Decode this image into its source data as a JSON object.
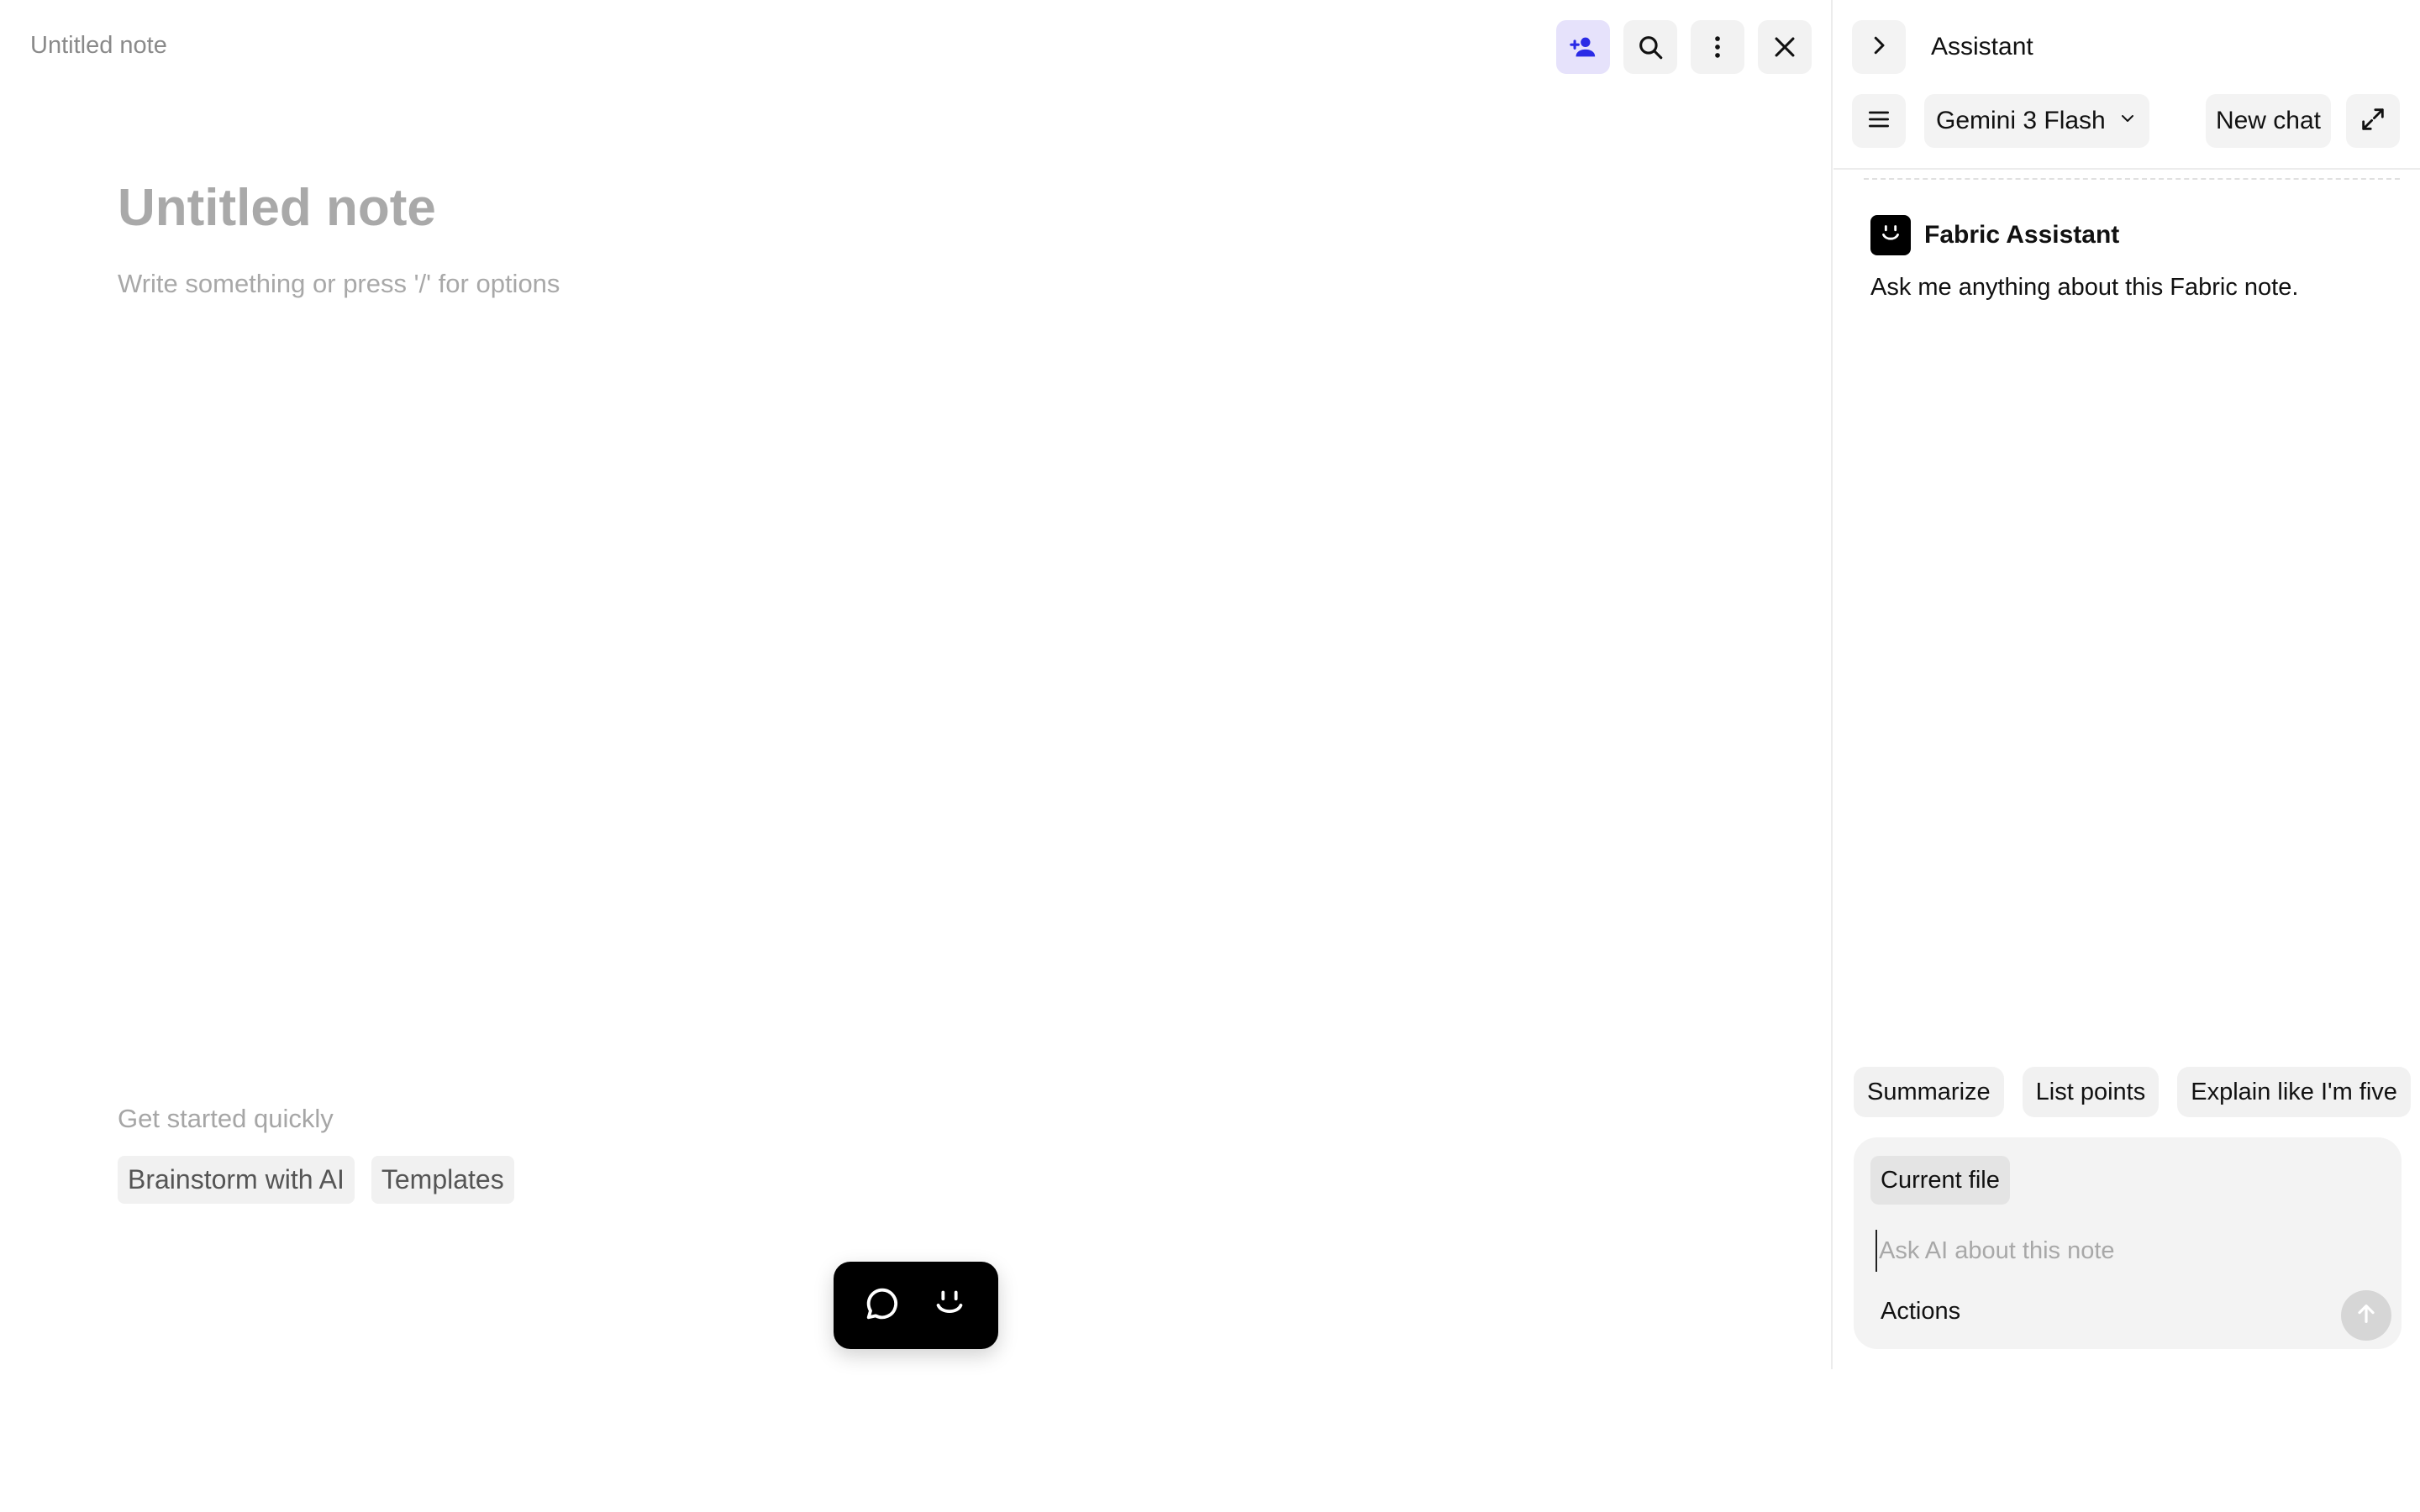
{
  "editor": {
    "breadcrumb_title": "Untitled note",
    "title_placeholder": "Untitled note",
    "body_placeholder": "Write something or press '/' for options",
    "quick_start": {
      "heading": "Get started quickly",
      "chips": [
        "Brainstorm with AI",
        "Templates"
      ]
    },
    "toolbar": {
      "icons": [
        "add-person-icon",
        "search-icon",
        "more-vertical-icon",
        "close-icon"
      ]
    },
    "floating_bar": {
      "icons": [
        "chat-bubble-icon",
        "assistant-face-icon"
      ]
    }
  },
  "assistant": {
    "title": "Assistant",
    "model": "Gemini 3 Flash",
    "new_chat_label": "New chat",
    "message": {
      "sender": "Fabric Assistant",
      "text": "Ask me anything about this Fabric note."
    },
    "suggestions": [
      "Summarize",
      "List points",
      "Explain like I'm five"
    ],
    "composer": {
      "context_chip": "Current file",
      "placeholder": "Ask AI about this note",
      "actions_label": "Actions"
    }
  },
  "colors": {
    "accent": "#2a2ae6",
    "accent_bg": "#e6e2fb",
    "chip_bg": "#f1f1f1",
    "muted_text": "#a8a8a8"
  }
}
